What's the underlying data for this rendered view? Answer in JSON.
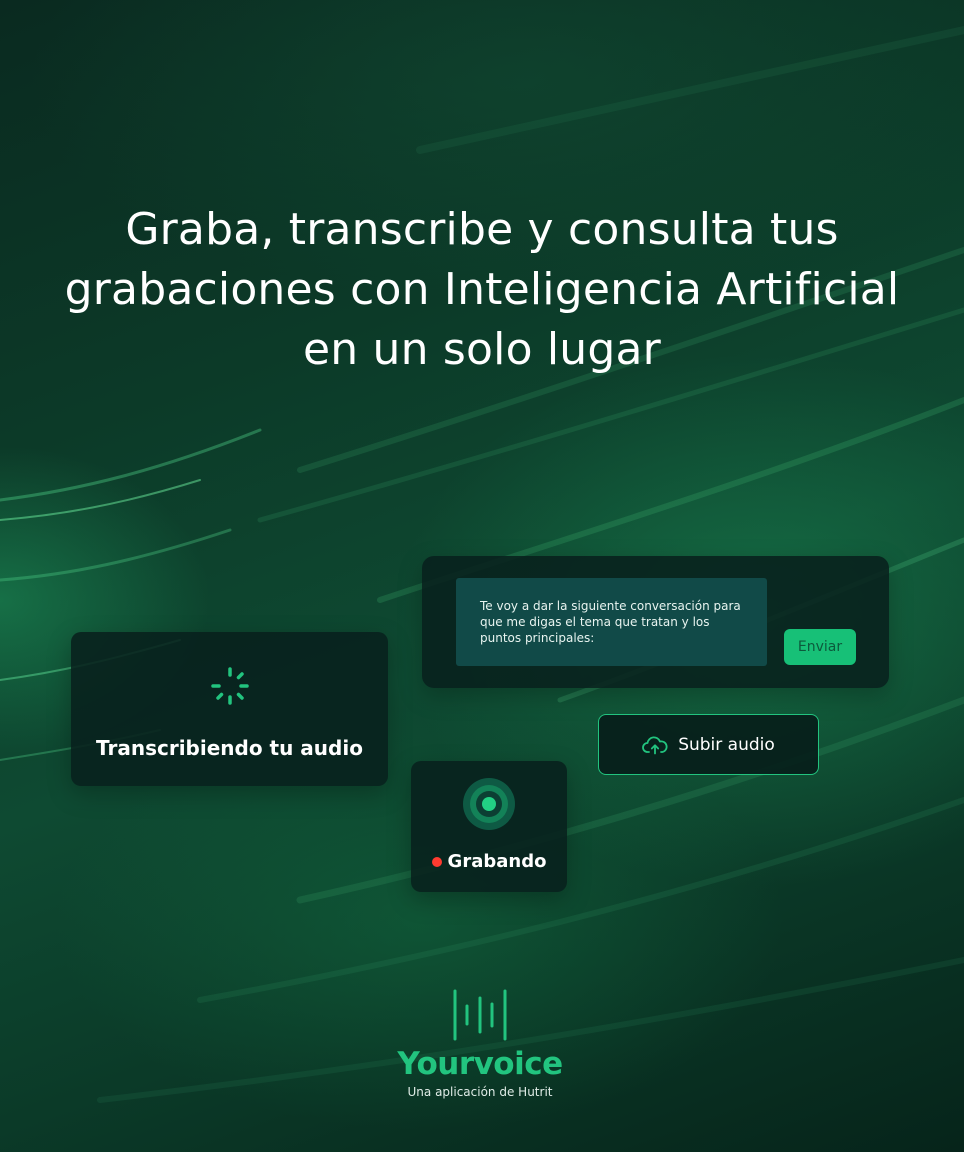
{
  "hero": {
    "headline": "Graba, transcribe y consulta tus grabaciones con Inteligencia Artificial en un solo lugar"
  },
  "transcription_card": {
    "status_label": "Transcribiendo tu audio",
    "icon": "loading-spinner-icon"
  },
  "chat_card": {
    "prompt_text": "Te voy a dar la siguiente conversación para que me digas el tema que tratan y los puntos principales:",
    "send_label": "Enviar"
  },
  "upload": {
    "label": "Subir audio",
    "icon": "cloud-upload-icon"
  },
  "recording_card": {
    "status_label": "Grabando",
    "icon": "record-icon",
    "indicator_color": "#ff3b30"
  },
  "brand": {
    "name": "Yourvoice",
    "tagline": "Una aplicación de Hutrit",
    "icon": "soundwave-icon",
    "accent_color": "#22c47f"
  }
}
